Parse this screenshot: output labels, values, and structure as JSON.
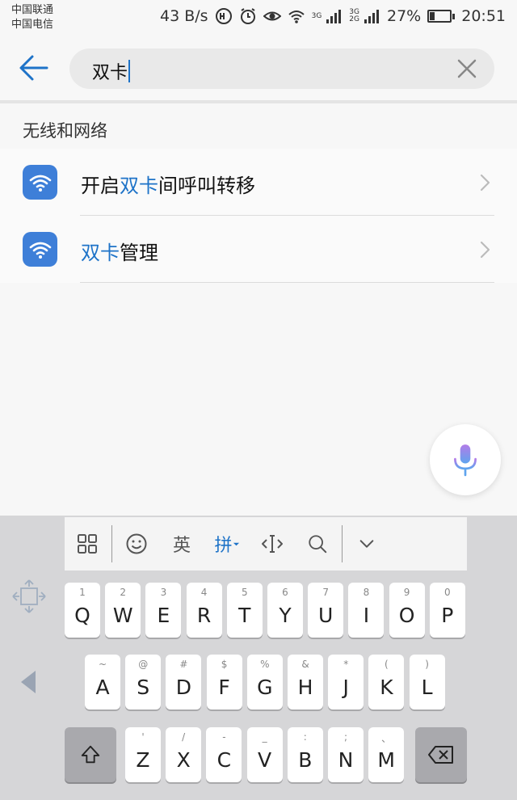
{
  "status_bar": {
    "carrier1": "中国联通",
    "carrier2": "中国电信",
    "speed": "43 B/s",
    "net1": "3G",
    "net2a": "3G",
    "net2b": "2G",
    "battery": "27%",
    "battery_level": 0.27,
    "time": "20:51"
  },
  "search": {
    "query": "双卡"
  },
  "section": {
    "title": "无线和网络"
  },
  "results": [
    {
      "pre": "开启",
      "hl": "双卡",
      "post": "间呼叫转移",
      "icon": "wifi-icon"
    },
    {
      "pre": "",
      "hl": "双卡",
      "post": "管理",
      "icon": "wifi-icon"
    }
  ],
  "keyboard": {
    "toolbar": {
      "english": "英",
      "pinyin": "拼"
    },
    "row1": [
      {
        "sub": "1",
        "main": "Q"
      },
      {
        "sub": "2",
        "main": "W"
      },
      {
        "sub": "3",
        "main": "E"
      },
      {
        "sub": "4",
        "main": "R"
      },
      {
        "sub": "5",
        "main": "T"
      },
      {
        "sub": "6",
        "main": "Y"
      },
      {
        "sub": "7",
        "main": "U"
      },
      {
        "sub": "8",
        "main": "I"
      },
      {
        "sub": "9",
        "main": "O"
      },
      {
        "sub": "0",
        "main": "P"
      }
    ],
    "row2": [
      {
        "sub": "~",
        "main": "A"
      },
      {
        "sub": "@",
        "main": "S"
      },
      {
        "sub": "#",
        "main": "D"
      },
      {
        "sub": "$",
        "main": "F"
      },
      {
        "sub": "%",
        "main": "G"
      },
      {
        "sub": "&",
        "main": "H"
      },
      {
        "sub": "*",
        "main": "J"
      },
      {
        "sub": "(",
        "main": "K"
      },
      {
        "sub": ")",
        "main": "L"
      }
    ],
    "row3": [
      {
        "sub": "'",
        "main": "Z"
      },
      {
        "sub": "/",
        "main": "X"
      },
      {
        "sub": "-",
        "main": "C"
      },
      {
        "sub": "_",
        "main": "V"
      },
      {
        "sub": ":",
        "main": "B"
      },
      {
        "sub": ";",
        "main": "N"
      },
      {
        "sub": "、",
        "main": "M"
      }
    ]
  },
  "colors": {
    "accent": "#1e73c8",
    "icon_bg": "#3e7fd8",
    "mic": "#8b7fe6"
  }
}
